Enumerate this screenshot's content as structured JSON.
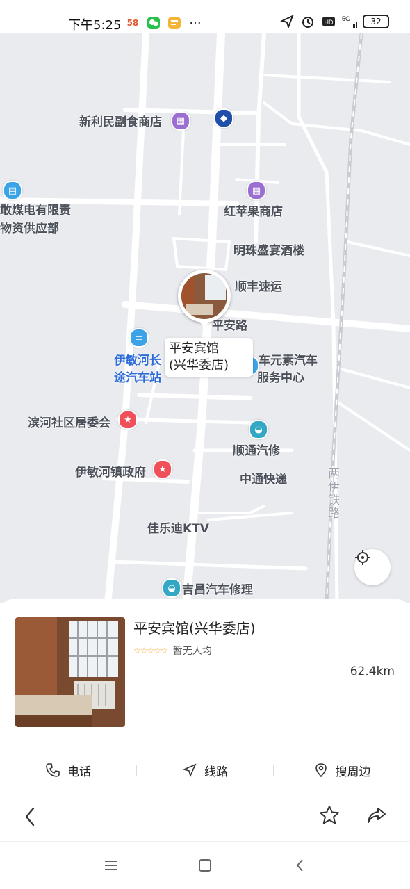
{
  "status_bar": {
    "time": "下午5:25",
    "icons_left": [
      "58-app-icon",
      "wechat-icon",
      "note-app-icon",
      "more-dots-icon"
    ],
    "icons_right": [
      "location-arrow-icon",
      "alarm-icon",
      "hd-icon",
      "5g-signal-icon"
    ],
    "battery": "32"
  },
  "map": {
    "labels": {
      "shop1": "新利民副食商店",
      "shop2": "红苹果商店",
      "company_line1": "敢煤电有限责",
      "company_line2": "物资供应部",
      "hotel2": "明珠盛宴酒楼",
      "express1": "顺丰速运",
      "road": "平安路",
      "bus_line1": "伊敏河长",
      "bus_line2": "途汽车站",
      "car_line1": "车元素汽车",
      "car_line2": "服务中心",
      "community": "滨河社区居委会",
      "car_repair1": "顺通汽修",
      "gov": "伊敏河镇政府",
      "express2": "中通快递",
      "railway": "两伊铁路",
      "ktv": "佳乐迪KTV",
      "car_repair2": "吉昌汽车修理"
    },
    "marker_label_line1": "平安宾馆",
    "marker_label_line2": "(兴华委店)"
  },
  "place": {
    "name": "平安宾馆(兴华委店)",
    "stars": "☆☆☆☆☆",
    "rating_text": "暂无人均",
    "distance": "62.4km"
  },
  "actions": {
    "phone": "电话",
    "route": "线路",
    "nearby": "搜周边"
  },
  "colors": {
    "map_bg": "#e9ebef",
    "road": "#ffffff",
    "poi_purple": "#9a6fd1",
    "poi_red": "#f0505a",
    "poi_blue": "#3ba3e6",
    "poi_teal": "#34a7c4"
  }
}
